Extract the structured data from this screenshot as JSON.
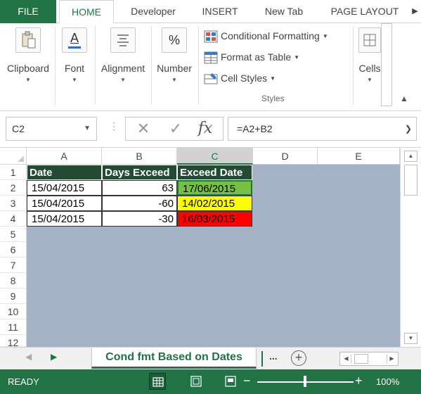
{
  "tabs": {
    "file": "FILE",
    "home": "HOME",
    "developer": "Developer",
    "insert": "INSERT",
    "new_tab": "New Tab",
    "page_layout": "PAGE LAYOUT"
  },
  "ribbon": {
    "clipboard": "Clipboard",
    "font": "Font",
    "alignment": "Alignment",
    "number": "Number",
    "conditional_formatting": "Conditional Formatting",
    "format_as_table": "Format as Table",
    "cell_styles": "Cell Styles",
    "styles_group": "Styles",
    "cells": "Cells",
    "font_icon_letter": "A",
    "number_icon_glyph": "%"
  },
  "formula_bar": {
    "name_box": "C2",
    "formula": "=A2+B2",
    "fx_label": "fx"
  },
  "columns": [
    "A",
    "B",
    "C",
    "D",
    "E"
  ],
  "selected_column": "C",
  "rows": [
    "1",
    "2",
    "3",
    "4",
    "5",
    "6",
    "7",
    "8",
    "9",
    "10",
    "11",
    "12"
  ],
  "table": {
    "headers": [
      "Date",
      "Days Exceed",
      "Exceed Date"
    ],
    "rows": [
      {
        "date": "15/04/2015",
        "days": "63",
        "exceed": "17/06/2015",
        "status_color": "#76c043"
      },
      {
        "date": "15/04/2015",
        "days": "-60",
        "exceed": "14/02/2015",
        "status_color": "#ffff00"
      },
      {
        "date": "15/04/2015",
        "days": "-30",
        "exceed": "16/03/2015",
        "status_color": "#ff0000"
      }
    ]
  },
  "sheets": {
    "active": "Cond fmt Based on Dates",
    "more": "..."
  },
  "status": {
    "ready": "READY",
    "zoom": "100%"
  },
  "colors": {
    "accent": "#217346",
    "header_fill": "#234a33",
    "background": "#a5b2c5"
  }
}
